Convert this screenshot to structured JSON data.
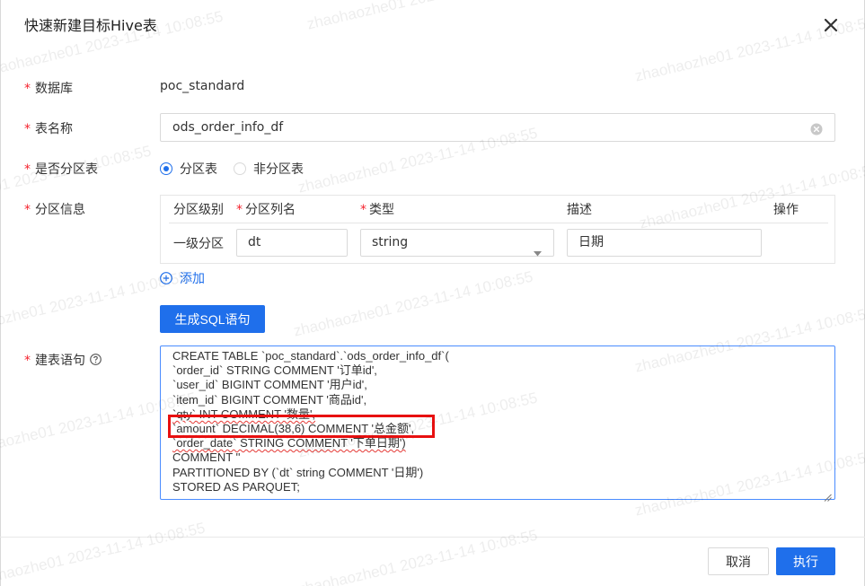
{
  "dialog": {
    "title": "快速新建目标Hive表",
    "close_icon": "close-icon"
  },
  "form": {
    "required_mark": "*",
    "database": {
      "label": "数据库",
      "value": "poc_standard"
    },
    "table_name": {
      "label": "表名称",
      "value": "ods_order_info_df"
    },
    "is_partitioned": {
      "label": "是否分区表",
      "options": [
        {
          "label": "分区表",
          "checked": true
        },
        {
          "label": "非分区表",
          "checked": false
        }
      ]
    },
    "partition_info": {
      "label": "分区信息",
      "columns": [
        "分区级别",
        "分区列名",
        "类型",
        "描述",
        "操作"
      ],
      "rows": [
        {
          "level": "一级分区",
          "name": "dt",
          "type": "string",
          "desc": "日期"
        }
      ],
      "add_label": "添加"
    },
    "generate_sql_label": "生成SQL语句",
    "ddl": {
      "label": "建表语句",
      "lines": [
        "CREATE TABLE `poc_standard`.`ods_order_info_df`(",
        "`order_id` STRING COMMENT '订单id',",
        "`user_id` BIGINT COMMENT '用户id',",
        "`item_id` BIGINT COMMENT '商品id',",
        "`qty` INT COMMENT '数量',",
        "`amount` DECIMAL(38,6) COMMENT '总金额',",
        "`order_date` STRING COMMENT '下单日期')",
        "COMMENT ''",
        "PARTITIONED BY (`dt` string COMMENT '日期')",
        "STORED AS PARQUET;"
      ]
    }
  },
  "footer": {
    "cancel_label": "取消",
    "ok_label": "执行"
  },
  "watermark": {
    "text_full": "zhaohaozhe01 2023-11-14 10:08:55"
  },
  "colors": {
    "primary": "#1f6feb",
    "required": "#f5222d",
    "highlight_box": "#e81010"
  }
}
